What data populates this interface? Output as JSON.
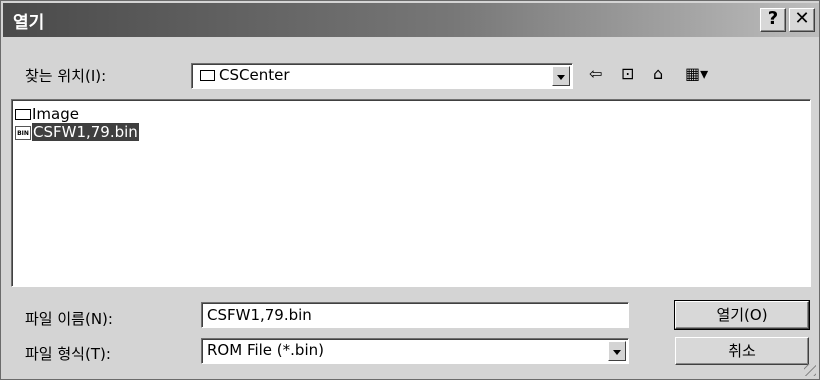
{
  "window": {
    "title": "열기"
  },
  "titlebar": {
    "help_label": "?",
    "close_label": "✕"
  },
  "lookin": {
    "label": "찾는 위치(I):",
    "value": "CSCenter"
  },
  "toolbar": {
    "back_icon": "back-arrow-icon",
    "up_icon": "up-one-level-icon",
    "new_folder_icon": "new-folder-icon",
    "view_icon": "view-menu-icon"
  },
  "files": [
    {
      "name": "Image",
      "icon": "folder-icon",
      "selected": false
    },
    {
      "name": "CSFW1,79.bin",
      "icon": "bin-file-icon",
      "icon_text": "BIN",
      "selected": true
    }
  ],
  "filename": {
    "label": "파일 이름(N):",
    "value": "CSFW1,79.bin"
  },
  "filetype": {
    "label": "파일 형식(T):",
    "value": "ROM File (*.bin)"
  },
  "buttons": {
    "open_label": "열기(O)",
    "cancel_label": "취소"
  }
}
